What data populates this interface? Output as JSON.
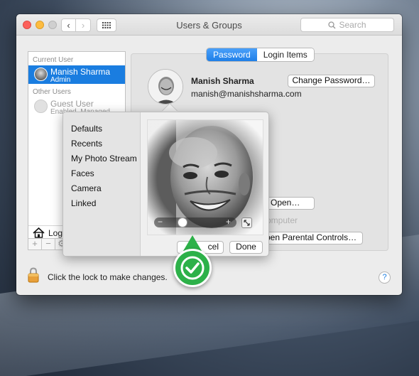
{
  "window": {
    "title": "Users & Groups",
    "search_placeholder": "Search"
  },
  "sidebar": {
    "current_user_header": "Current User",
    "current_user": {
      "name": "Manish Sharma",
      "role": "Admin"
    },
    "other_users_header": "Other Users",
    "guest_user": {
      "name": "Guest User",
      "role": "Enabled, Managed"
    },
    "login_options_label": "Log",
    "footer_buttons": [
      "+",
      "−",
      "⚙"
    ]
  },
  "tabs": [
    "Password",
    "Login Items"
  ],
  "active_tab": "Password",
  "user": {
    "name": "Manish Sharma",
    "email": "manish@manishsharma.com"
  },
  "buttons": {
    "change_password": "Change Password…",
    "open": "Open…",
    "open_parental": "pen Parental Controls…",
    "cancel": "cel",
    "done": "Done"
  },
  "partial_text": {
    "computer": "omputer"
  },
  "footer": {
    "lock_text": "Click the lock to make changes.",
    "help": "?"
  },
  "picker": {
    "sources": [
      "Defaults",
      "Recents",
      "My Photo Stream",
      "Faces",
      "Camera",
      "Linked"
    ],
    "zoom_level": 0.25
  },
  "colors": {
    "accent": "#1a7de0",
    "badge": "#2db149"
  }
}
